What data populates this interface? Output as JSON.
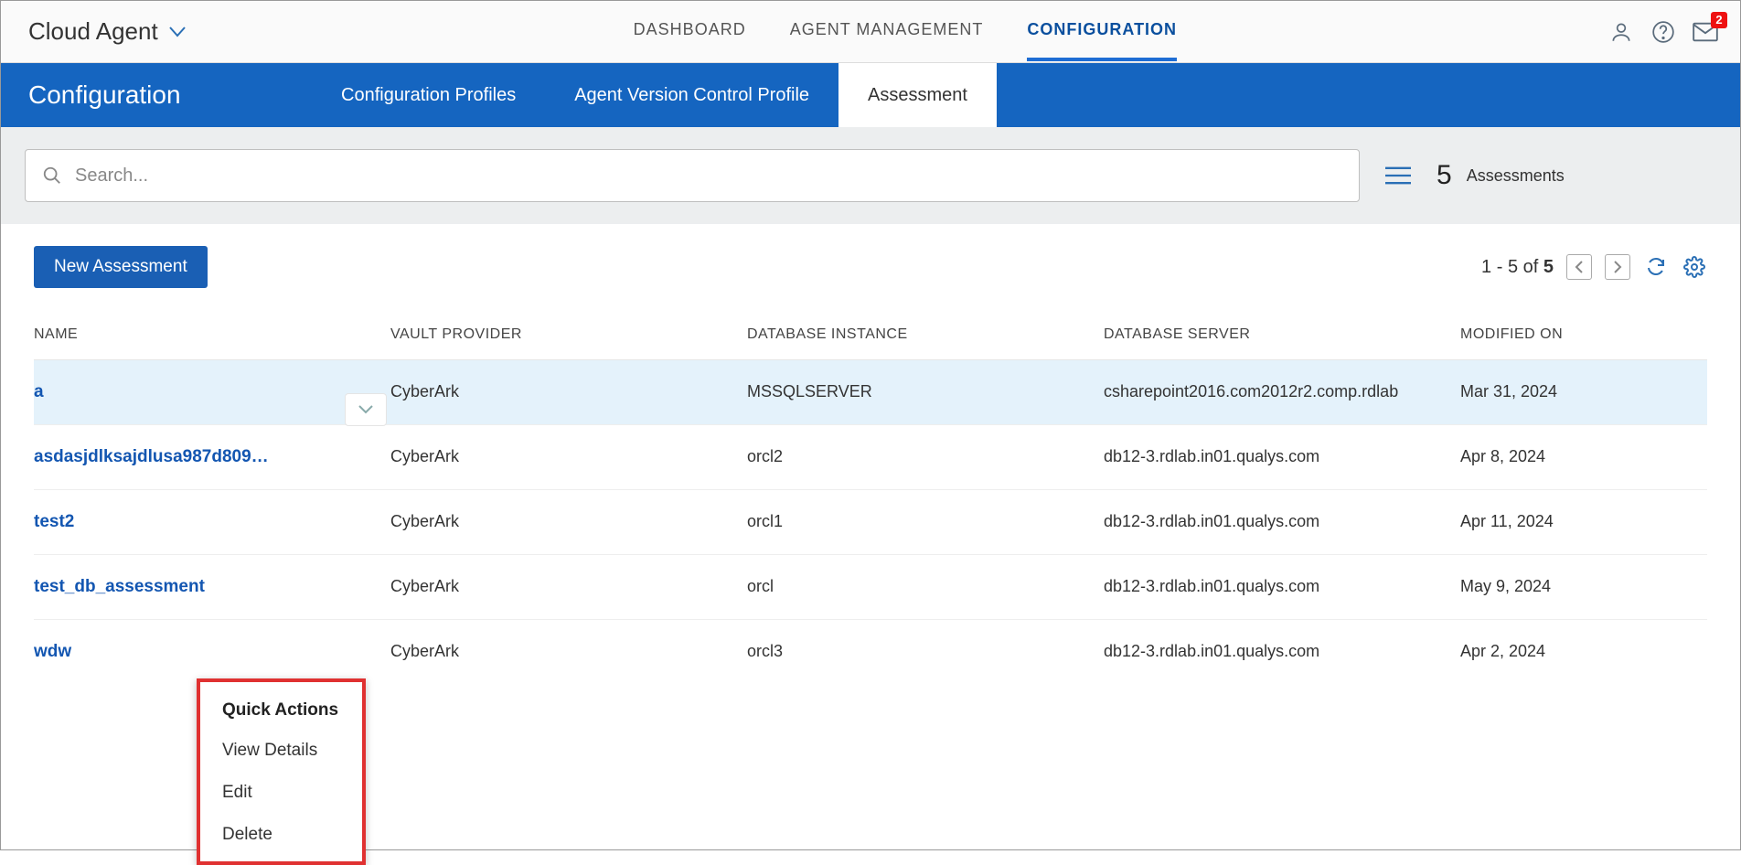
{
  "header": {
    "app_title": "Cloud Agent",
    "nav": {
      "dashboard": "DASHBOARD",
      "agent_management": "AGENT MANAGEMENT",
      "configuration": "CONFIGURATION"
    },
    "message_badge": "2"
  },
  "subheader": {
    "title": "Configuration",
    "tabs": {
      "profiles": "Configuration Profiles",
      "version_control": "Agent Version Control Profile",
      "assessment": "Assessment"
    }
  },
  "search": {
    "placeholder": "Search..."
  },
  "count": {
    "value": "5",
    "label": "Assessments"
  },
  "toolbar": {
    "new_assessment": "New Assessment",
    "range_prefix": "1 - 5",
    "range_of": " of ",
    "range_total": "5"
  },
  "columns": {
    "name": "NAME",
    "vault_provider": "VAULT PROVIDER",
    "db_instance": "DATABASE INSTANCE",
    "db_server": "DATABASE SERVER",
    "modified": "MODIFIED ON"
  },
  "rows": [
    {
      "name": "a",
      "provider": "CyberArk",
      "instance": "MSSQLSERVER",
      "server": "csharepoint2016.com2012r2.comp.rdlab",
      "modified": "Mar 31, 2024"
    },
    {
      "name": "asdasjdlksajdlusa987d809…",
      "provider": "CyberArk",
      "instance": "orcl2",
      "server": "db12-3.rdlab.in01.qualys.com",
      "modified": "Apr 8, 2024"
    },
    {
      "name": "test2",
      "provider": "CyberArk",
      "instance": "orcl1",
      "server": "db12-3.rdlab.in01.qualys.com",
      "modified": "Apr 11, 2024"
    },
    {
      "name": "test_db_assessment",
      "provider": "CyberArk",
      "instance": "orcl",
      "server": "db12-3.rdlab.in01.qualys.com",
      "modified": "May 9, 2024"
    },
    {
      "name": "wdw",
      "provider": "CyberArk",
      "instance": "orcl3",
      "server": "db12-3.rdlab.in01.qualys.com",
      "modified": "Apr 2, 2024"
    }
  ],
  "quick_actions": {
    "title": "Quick Actions",
    "view": "View Details",
    "edit": "Edit",
    "delete": "Delete"
  }
}
